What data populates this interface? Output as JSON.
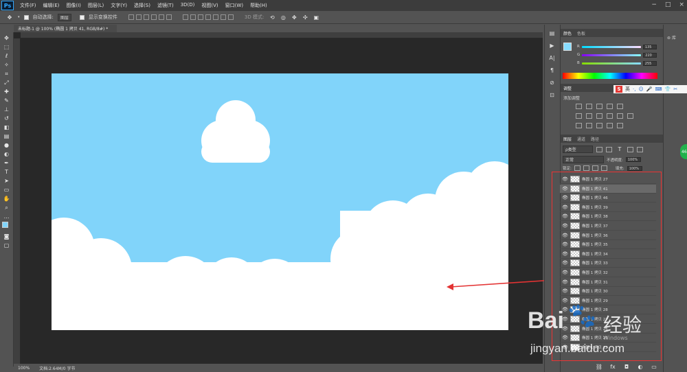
{
  "app": {
    "logo": "Ps"
  },
  "menu": [
    "文件(F)",
    "编辑(E)",
    "图像(I)",
    "图层(L)",
    "文字(Y)",
    "选择(S)",
    "滤镜(T)",
    "3D(D)",
    "视图(V)",
    "窗口(W)",
    "帮助(H)"
  ],
  "window_controls": [
    "−",
    "□",
    "×"
  ],
  "options": {
    "auto_select_label": "自动选择:",
    "auto_select_value": "图层",
    "show_transform_label": "显示变换控件",
    "mode_3d_label": "3D 模式:"
  },
  "document": {
    "tab_title": "未标题-1 @ 100% (椭圆 1 拷贝 41, RGB/8#) *",
    "zoom": "100%",
    "doc_info": "文档:2.64M/0 字节"
  },
  "color_panel": {
    "tab_color": "颜色",
    "tab_swatches": "色板",
    "r_label": "R",
    "g_label": "G",
    "b_label": "B",
    "r": "135",
    "g": "220",
    "b": "255",
    "foreground": "#87dcff"
  },
  "adjustments_panel": {
    "tab": "调整",
    "add_label": "添加调整"
  },
  "layers_panel": {
    "tab_layers": "图层",
    "tab_channels": "通道",
    "tab_paths": "路径",
    "filter_kind": "ρ类型",
    "blend_mode": "正常",
    "opacity_label": "不透明度:",
    "opacity": "100%",
    "lock_label": "锁定:",
    "fill_label": "填充:",
    "fill": "100%",
    "layers": [
      {
        "name": "椭圆 1 拷贝 27",
        "selected": false
      },
      {
        "name": "椭圆 1 拷贝 41",
        "selected": true
      },
      {
        "name": "椭圆 1 拷贝 46",
        "selected": false
      },
      {
        "name": "椭圆 1 拷贝 39",
        "selected": false
      },
      {
        "name": "椭圆 1 拷贝 38",
        "selected": false
      },
      {
        "name": "椭圆 1 拷贝 37",
        "selected": false
      },
      {
        "name": "椭圆 1 拷贝 36",
        "selected": false
      },
      {
        "name": "椭圆 1 拷贝 35",
        "selected": false
      },
      {
        "name": "椭圆 1 拷贝 34",
        "selected": false
      },
      {
        "name": "椭圆 1 拷贝 33",
        "selected": false
      },
      {
        "name": "椭圆 1 拷贝 32",
        "selected": false
      },
      {
        "name": "椭圆 1 拷贝 31",
        "selected": false
      },
      {
        "name": "椭圆 1 拷贝 30",
        "selected": false
      },
      {
        "name": "椭圆 1 拷贝 29",
        "selected": false
      },
      {
        "name": "椭圆 1 拷贝 28",
        "selected": false
      },
      {
        "name": "椭圆 1 拷贝 27",
        "selected": false
      },
      {
        "name": "椭圆 1 拷贝 26",
        "selected": false
      },
      {
        "name": "椭圆 1 拷贝 25",
        "selected": false
      },
      {
        "name": "椭圆 1 拷贝 22",
        "selected": false
      }
    ]
  },
  "libraries": {
    "label": "库"
  },
  "ime": {
    "logo": "S",
    "lang": "英"
  },
  "watermark": {
    "brand": "Bai",
    "brand_cn": "经验",
    "url": "jingyan.baidu.com",
    "windows_text": "Windows"
  },
  "canvas_color": "#81d4fa",
  "cloud_color": "#ffffff",
  "annotation_color": "#e33333"
}
